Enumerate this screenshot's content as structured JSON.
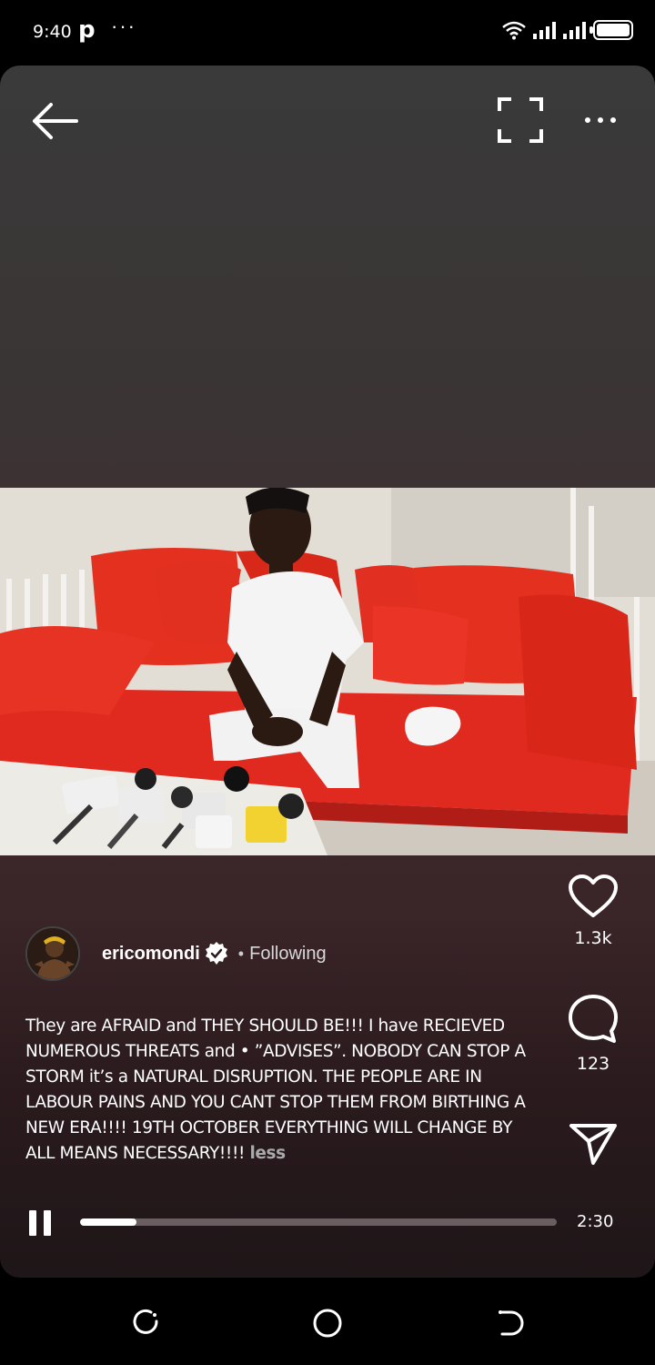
{
  "status_bar": {
    "time": "9:40",
    "app_badge": "p",
    "more": "···",
    "icons": [
      "wifi-icon",
      "signal-icon",
      "signal-icon",
      "battery-icon"
    ]
  },
  "top_bar": {
    "back_icon": "arrow-left-icon",
    "expand_icon": "fullscreen-icon",
    "more_icon": "more-horizontal-icon"
  },
  "actions": {
    "like_icon": "heart-icon",
    "like_count": "1.3k",
    "comment_icon": "comment-bubble-icon",
    "comment_count": "123",
    "share_icon": "send-icon"
  },
  "author": {
    "username": "ericomondi",
    "verified_icon": "verified-badge-icon",
    "separator": "•",
    "follow_status": "Following"
  },
  "caption": {
    "text": "They are AFRAID and THEY SHOULD BE!!! I have RECIEVED NUMEROUS THREATS and • ”ADVISES”. NOBODY CAN STOP A STORM it’s a NATURAL DISRUPTION. THE PEOPLE ARE IN LABOUR PAINS AND YOU CANT STOP THEM FROM BIRTHING A NEW ERA!!!! 19TH OCTOBER EVERYTHING WILL CHANGE BY ALL MEANS NECESSARY!!!! ",
    "less_label": "less"
  },
  "playback": {
    "state_icon": "pause-icon",
    "progress_fraction": 0.118,
    "duration": "2:30"
  },
  "nav_bar": {
    "items": [
      "recents-icon",
      "home-icon",
      "back-icon"
    ]
  },
  "colors": {
    "sofa_red": "#e0291f",
    "background_top": "#3a3a3a",
    "background_bottom": "#1e1618"
  }
}
